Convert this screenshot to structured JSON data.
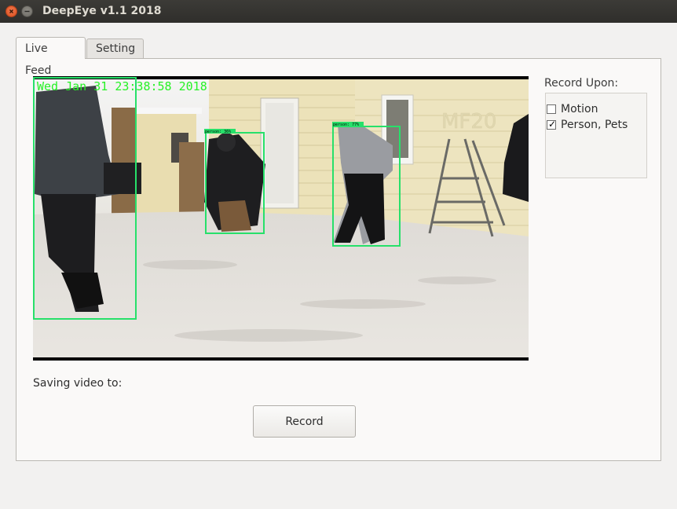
{
  "window": {
    "title": "DeepEye v1.1 2018"
  },
  "tabs": [
    {
      "label": "Live Feed",
      "active": true
    },
    {
      "label": "Setting",
      "active": false
    }
  ],
  "video": {
    "timestamp": "Wed Jan 31 23:38:58 2018",
    "detections": [
      {
        "label": "person: 36%",
        "color": "#27e06a"
      },
      {
        "label": "person: 77%",
        "color": "#27e06a"
      },
      {
        "label": "",
        "color": "#27e06a"
      }
    ],
    "watermark": "MF20"
  },
  "record_upon": {
    "label": "Record Upon:",
    "options": [
      {
        "label": "Motion",
        "checked": false
      },
      {
        "label": "Person, Pets",
        "checked": true
      }
    ]
  },
  "saving_label": "Saving video to:",
  "record_button": "Record",
  "colors": {
    "detection_box": "#27e06a",
    "timestamp": "#27f227",
    "titlebar": "#3c3b37",
    "close_button": "#e95420"
  }
}
